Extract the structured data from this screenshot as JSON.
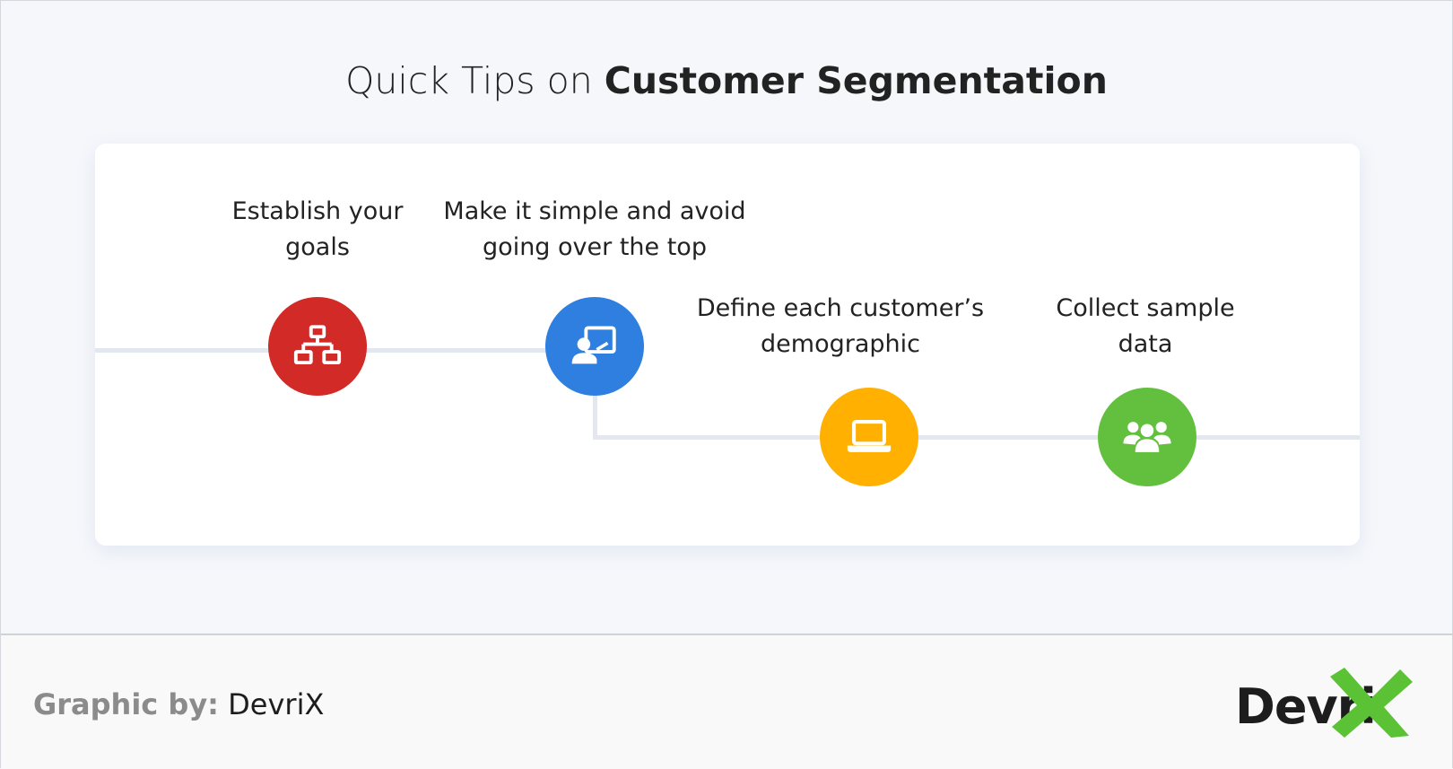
{
  "header": {
    "title_light": "Quick Tips on",
    "title_bold": "Customer Segmentation"
  },
  "steps": [
    {
      "label_line1": "Establish your",
      "label_line2": "goals",
      "icon": "sitemap-icon",
      "color": "#d22a27"
    },
    {
      "label_line1": "Make it simple and avoid",
      "label_line2": "going over the top",
      "icon": "presenter-icon",
      "color": "#2f7fe0"
    },
    {
      "label_line1": "Define each customer’s",
      "label_line2": "demographic",
      "icon": "laptop-icon",
      "color": "#ffb000"
    },
    {
      "label_line1": "Collect sample",
      "label_line2": "data",
      "icon": "users-icon",
      "color": "#63c03f"
    }
  ],
  "footer": {
    "credit_key": "Graphic by:",
    "credit_value": "DevriX",
    "logo_text": "Devri",
    "logo_accent": "#5bc236"
  }
}
